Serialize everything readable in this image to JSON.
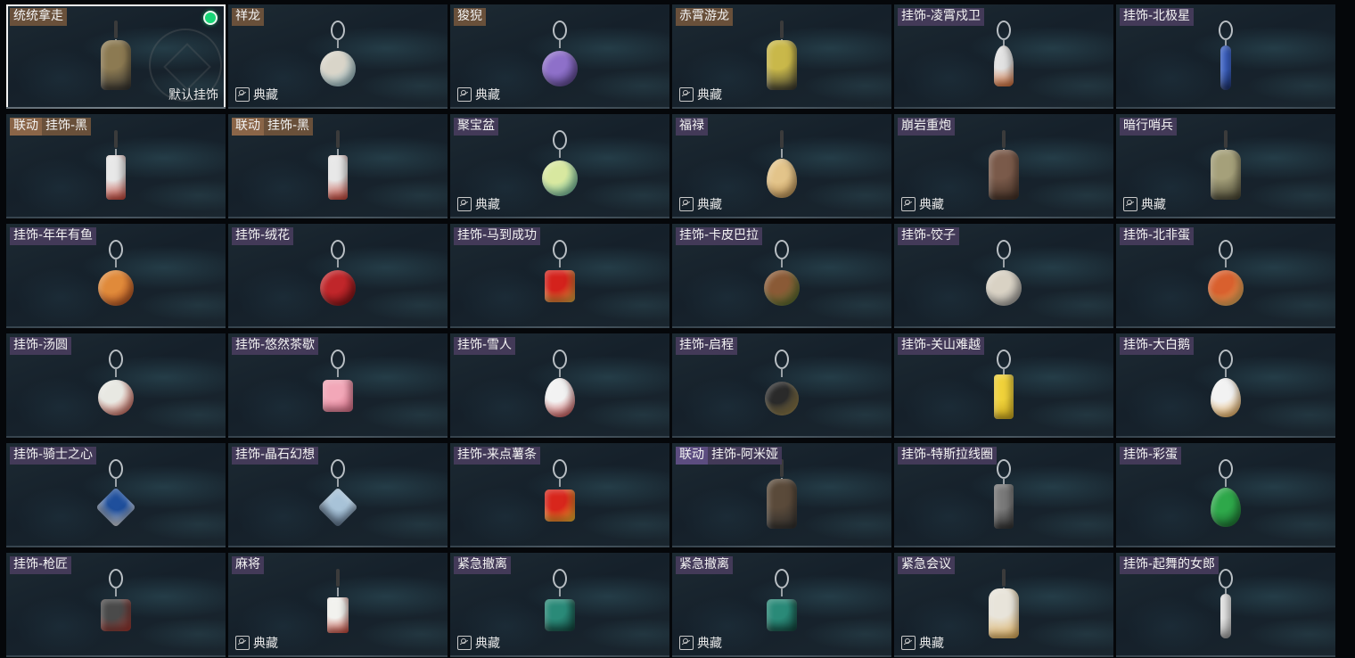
{
  "badge_text": "典藏",
  "default_text": "默认挂饰",
  "cards": [
    {
      "tags": [
        {
          "text": "统统拿走",
          "style": "orange"
        }
      ],
      "collection": false,
      "selected": true,
      "equipped": true,
      "default": true,
      "shape": "figure",
      "colors": [
        "#8c7a52",
        "#2a2a2a"
      ]
    },
    {
      "tags": [
        {
          "text": "祥龙",
          "style": "orange"
        }
      ],
      "collection": true,
      "shape": "round",
      "colors": [
        "#d9d5c9",
        "#7fb3c4"
      ]
    },
    {
      "tags": [
        {
          "text": "狻猊",
          "style": "orange"
        }
      ],
      "collection": true,
      "shape": "round",
      "colors": [
        "#8e70c9",
        "#4b3a7a"
      ]
    },
    {
      "tags": [
        {
          "text": "赤霄游龙",
          "style": "orange"
        }
      ],
      "collection": true,
      "shape": "figure",
      "colors": [
        "#c9b84a",
        "#2a2a2a"
      ]
    },
    {
      "tags": [
        {
          "text": "挂饰-凌霄戍卫",
          "style": "purple"
        }
      ],
      "collection": false,
      "shape": "rocket",
      "colors": [
        "#e2e2e2",
        "#d0642a"
      ]
    },
    {
      "tags": [
        {
          "text": "挂饰-北极星",
          "style": "purple"
        }
      ],
      "collection": false,
      "shape": "thin",
      "colors": [
        "#3b62c7",
        "#1a2e66"
      ]
    },
    {
      "tags": [
        {
          "text": "联动",
          "style": "collab-orange"
        },
        {
          "text": "挂饰-黑",
          "style": "orange"
        }
      ],
      "collection": false,
      "shape": "tall",
      "colors": [
        "#e8e8e8",
        "#c0392b"
      ]
    },
    {
      "tags": [
        {
          "text": "联动",
          "style": "collab-orange"
        },
        {
          "text": "挂饰-黑",
          "style": "orange"
        }
      ],
      "collection": false,
      "shape": "tall",
      "colors": [
        "#e8e8e8",
        "#c0392b"
      ]
    },
    {
      "tags": [
        {
          "text": "聚宝盆",
          "style": "purple"
        }
      ],
      "collection": true,
      "shape": "round",
      "colors": [
        "#d8e8a0",
        "#4fb0a0"
      ]
    },
    {
      "tags": [
        {
          "text": "福禄",
          "style": "purple"
        }
      ],
      "collection": true,
      "shape": "egg",
      "colors": [
        "#e3c48a",
        "#b3874a"
      ]
    },
    {
      "tags": [
        {
          "text": "崩岩重炮",
          "style": "purple"
        }
      ],
      "collection": true,
      "shape": "figure",
      "colors": [
        "#7a5a4a",
        "#3a2a20"
      ]
    },
    {
      "tags": [
        {
          "text": "暗行哨兵",
          "style": "purple"
        }
      ],
      "collection": true,
      "shape": "figure",
      "colors": [
        "#a5a07a",
        "#3c3a2a"
      ]
    },
    {
      "tags": [
        {
          "text": "挂饰-年年有鱼",
          "style": "purple"
        }
      ],
      "collection": false,
      "shape": "round",
      "colors": [
        "#e08a3a",
        "#a8431c"
      ]
    },
    {
      "tags": [
        {
          "text": "挂饰-绒花",
          "style": "purple"
        }
      ],
      "collection": false,
      "shape": "round",
      "colors": [
        "#c0262a",
        "#6a0e10"
      ]
    },
    {
      "tags": [
        {
          "text": "挂饰-马到成功",
          "style": "purple"
        }
      ],
      "collection": false,
      "shape": "square",
      "colors": [
        "#d4221c",
        "#e0b340"
      ]
    },
    {
      "tags": [
        {
          "text": "挂饰-卡皮巴拉",
          "style": "purple"
        }
      ],
      "collection": false,
      "shape": "round",
      "colors": [
        "#8a5a36",
        "#4a7a2e"
      ]
    },
    {
      "tags": [
        {
          "text": "挂饰-饺子",
          "style": "purple"
        }
      ],
      "collection": false,
      "shape": "round",
      "colors": [
        "#d9d2c4",
        "#8e8e8e"
      ]
    },
    {
      "tags": [
        {
          "text": "挂饰-北非蛋",
          "style": "purple"
        }
      ],
      "collection": false,
      "shape": "round",
      "colors": [
        "#d9602e",
        "#f0d070"
      ]
    },
    {
      "tags": [
        {
          "text": "挂饰-汤圆",
          "style": "purple"
        }
      ],
      "collection": false,
      "shape": "round",
      "colors": [
        "#e8e8e2",
        "#c23a2a"
      ]
    },
    {
      "tags": [
        {
          "text": "挂饰-悠然茶歇",
          "style": "purple"
        }
      ],
      "collection": false,
      "shape": "square",
      "colors": [
        "#f2a7b8",
        "#d3667f"
      ]
    },
    {
      "tags": [
        {
          "text": "挂饰-雪人",
          "style": "purple"
        }
      ],
      "collection": false,
      "shape": "egg",
      "colors": [
        "#f2f2f2",
        "#c23030"
      ]
    },
    {
      "tags": [
        {
          "text": "挂饰-启程",
          "style": "purple"
        }
      ],
      "collection": false,
      "shape": "ring",
      "colors": [
        "#2a2a2a",
        "#c7a95a"
      ]
    },
    {
      "tags": [
        {
          "text": "挂饰-关山难越",
          "style": "purple"
        }
      ],
      "collection": false,
      "shape": "tall",
      "colors": [
        "#f0d23a",
        "#c9a51c"
      ]
    },
    {
      "tags": [
        {
          "text": "挂饰-大白鹅",
          "style": "purple"
        }
      ],
      "collection": false,
      "shape": "egg",
      "colors": [
        "#f2f2f2",
        "#e8a03a"
      ]
    },
    {
      "tags": [
        {
          "text": "挂饰-骑士之心",
          "style": "purple"
        }
      ],
      "collection": false,
      "shape": "diamond",
      "colors": [
        "#1f4f9c",
        "#e8e8e8"
      ]
    },
    {
      "tags": [
        {
          "text": "挂饰-晶石幻想",
          "style": "purple"
        }
      ],
      "collection": false,
      "shape": "diamond",
      "colors": [
        "#a8c3d8",
        "#5a6f88"
      ]
    },
    {
      "tags": [
        {
          "text": "挂饰-来点薯条",
          "style": "purple"
        }
      ],
      "collection": false,
      "shape": "square",
      "colors": [
        "#d8261c",
        "#f2c12e"
      ]
    },
    {
      "tags": [
        {
          "text": "联动",
          "style": "collab-purple"
        },
        {
          "text": "挂饰-阿米娅",
          "style": "purple"
        }
      ],
      "collection": false,
      "shape": "figure",
      "colors": [
        "#5a4a3a",
        "#2a2a2a"
      ]
    },
    {
      "tags": [
        {
          "text": "挂饰-特斯拉线圈",
          "style": "purple"
        }
      ],
      "collection": false,
      "shape": "tall",
      "colors": [
        "#7a7a7a",
        "#2a2a2a"
      ]
    },
    {
      "tags": [
        {
          "text": "挂饰-彩蛋",
          "style": "purple"
        }
      ],
      "collection": false,
      "shape": "egg",
      "colors": [
        "#2ea84a",
        "#1a6a2e"
      ]
    },
    {
      "tags": [
        {
          "text": "挂饰-枪匠",
          "style": "purple"
        }
      ],
      "collection": false,
      "shape": "square",
      "colors": [
        "#4a4a4a",
        "#a8322a"
      ]
    },
    {
      "tags": [
        {
          "text": "麻将",
          "style": "purple"
        }
      ],
      "collection": true,
      "shape": "tile",
      "colors": [
        "#f2f2ee",
        "#c0392b"
      ]
    },
    {
      "tags": [
        {
          "text": "紧急撤离",
          "style": "purple"
        }
      ],
      "collection": true,
      "shape": "square",
      "colors": [
        "#2a8a78",
        "#0f3a34"
      ]
    },
    {
      "tags": [
        {
          "text": "紧急撤离",
          "style": "purple"
        }
      ],
      "collection": true,
      "shape": "square",
      "colors": [
        "#2a8a78",
        "#0f3a34"
      ]
    },
    {
      "tags": [
        {
          "text": "紧急会议",
          "style": "purple"
        }
      ],
      "collection": true,
      "shape": "figure",
      "colors": [
        "#e8e4da",
        "#d9a54a"
      ]
    },
    {
      "tags": [
        {
          "text": "挂饰-起舞的女郎",
          "style": "purple"
        }
      ],
      "collection": false,
      "shape": "thin",
      "colors": [
        "#e8e8e8",
        "#9a9a9a"
      ]
    }
  ]
}
